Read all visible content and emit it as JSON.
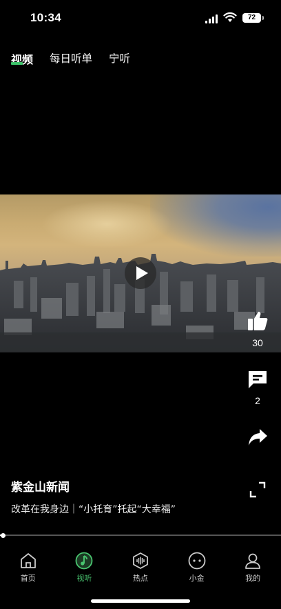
{
  "status_bar": {
    "time": "10:34",
    "battery": "72"
  },
  "tabs": [
    {
      "label": "视频",
      "active": true
    },
    {
      "label": "每日听单",
      "active": false
    },
    {
      "label": "宁听",
      "active": false
    }
  ],
  "actions": {
    "like_count": "30",
    "comment_count": "2"
  },
  "post": {
    "channel": "紫金山新闻",
    "headline": "改革在我身边｜“小托育”托起“大幸福”"
  },
  "progress": {
    "fraction": 0.01
  },
  "bottom_nav": [
    {
      "label": "首页",
      "icon": "home-icon",
      "active": false
    },
    {
      "label": "视听",
      "icon": "music-note-icon",
      "active": true
    },
    {
      "label": "热点",
      "icon": "hot-topics-icon",
      "active": false
    },
    {
      "label": "小金",
      "icon": "assistant-face-icon",
      "active": false
    },
    {
      "label": "我的",
      "icon": "profile-icon",
      "active": false
    }
  ],
  "colors": {
    "accent": "#3ec46b",
    "background": "#000000"
  }
}
